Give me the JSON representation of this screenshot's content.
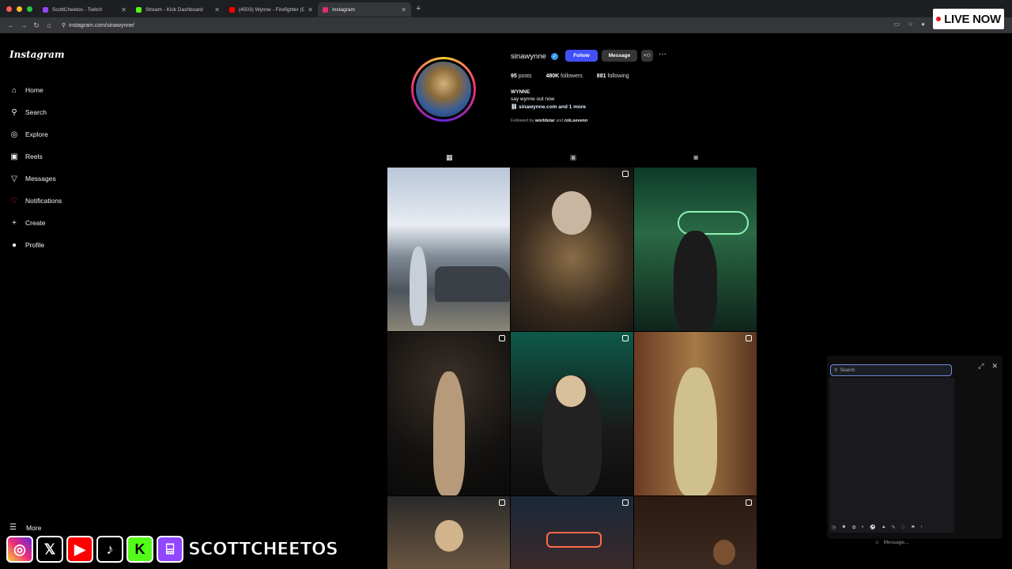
{
  "browser": {
    "tabs": [
      {
        "label": "ScottCheetos - Twitch",
        "color": "#9146ff"
      },
      {
        "label": "Stream - Kick Dashboard",
        "color": "#53fc18"
      },
      {
        "label": "(4503) Wynne - Firefighter (O",
        "color": "#ff0000"
      },
      {
        "label": "Instagram",
        "color": "#e1306c"
      }
    ],
    "url": "instagram.com/sinawynne/"
  },
  "live_badge": "LIVE NOW",
  "sidebar": {
    "logo": "Instagram",
    "items": [
      {
        "label": "Home",
        "icon": "home-icon"
      },
      {
        "label": "Search",
        "icon": "search-icon"
      },
      {
        "label": "Explore",
        "icon": "explore-icon"
      },
      {
        "label": "Reels",
        "icon": "reels-icon"
      },
      {
        "label": "Messages",
        "icon": "messages-icon"
      },
      {
        "label": "Notifications",
        "icon": "heart-icon"
      },
      {
        "label": "Create",
        "icon": "plus-icon"
      },
      {
        "label": "Profile",
        "icon": "avatar-icon"
      }
    ],
    "more": "More"
  },
  "profile": {
    "username": "sinawynne",
    "follow_label": "Follow",
    "message_label": "Message",
    "posts_count": "95",
    "posts_label": "posts",
    "followers_count": "480K",
    "followers_label": "followers",
    "following_count": "881",
    "following_label": "following",
    "name": "WYNNE",
    "bio": "say wynne out now",
    "link": "sinawynne.com and 1 more",
    "followed_by_prefix": "Followed by",
    "followed_by_1": "worldstar",
    "followed_by_and": "and",
    "followed_by_2": "rob.sevenn"
  },
  "chat": {
    "search_placeholder": "Search",
    "message_placeholder": "Message..."
  },
  "overlay": {
    "handle": "SCOTTCHEETOS"
  }
}
